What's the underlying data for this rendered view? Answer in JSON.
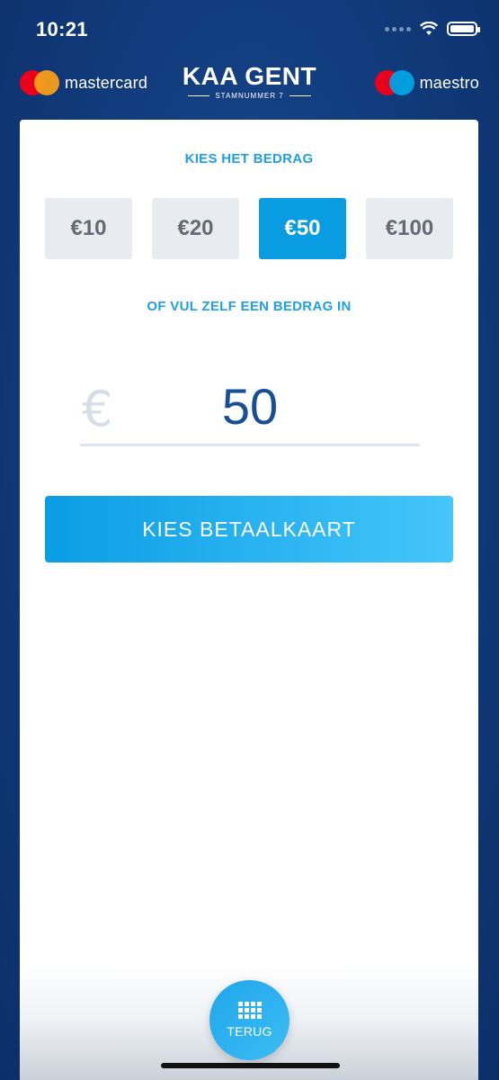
{
  "status_bar": {
    "time": "10:21",
    "icons": [
      "signal-dots-icon",
      "wifi-icon",
      "battery-icon"
    ]
  },
  "header": {
    "left_logo": "mastercard",
    "club_name": "KAA GENT",
    "club_subtitle": "STAMNUMMER 7",
    "right_logo": "maestro"
  },
  "main": {
    "choose_amount_title": "KIES HET BEDRAG",
    "amount_options": [
      "€10",
      "€20",
      "€50",
      "€100"
    ],
    "selected_amount": "€50",
    "custom_amount_title": "OF VUL ZELF EEN BEDRAG IN",
    "currency_symbol": "€",
    "amount_value": "50",
    "pay_button": "KIES BETAALKAART"
  },
  "footer": {
    "back_label": "TERUG",
    "back_icon": "grid-icon"
  },
  "colors": {
    "accent": "#0a9ce1",
    "title_blue": "#1ea0e6",
    "amount_text": "#164e9a",
    "background": "#123d7f"
  }
}
